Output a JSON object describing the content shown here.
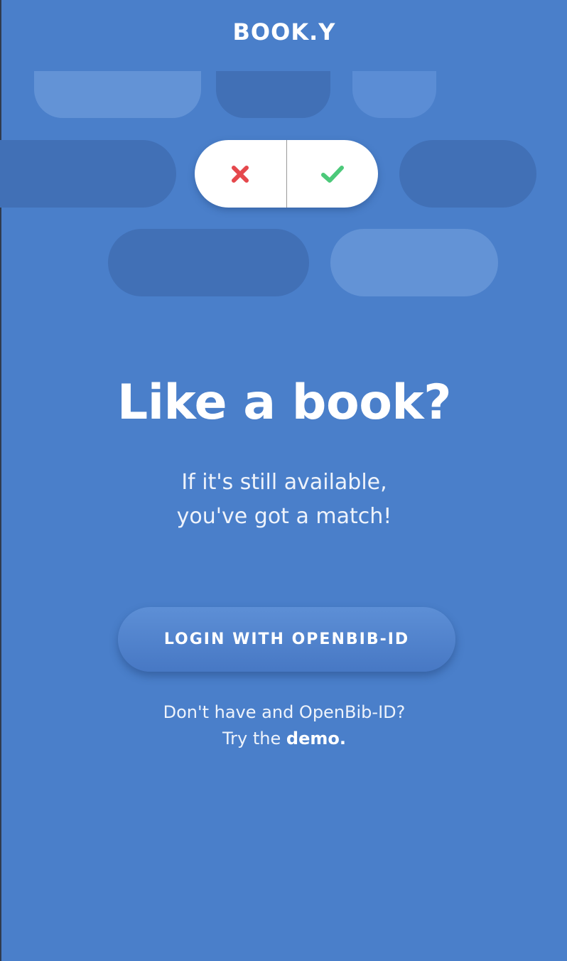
{
  "app": {
    "logo": "BOOK.Y"
  },
  "hero": {
    "headline": "Like a book?",
    "subline_1": "If it's still available,",
    "subline_2": "you've got a match!"
  },
  "toggle": {
    "reject_icon": "x-icon",
    "accept_icon": "check-icon"
  },
  "login": {
    "button_label": "LOGIN WITH OPENBIB-ID"
  },
  "helper": {
    "line_1": "Don't have and OpenBib-ID?",
    "line_2_prefix": "Try the ",
    "demo_link": "demo."
  },
  "colors": {
    "background": "#4a7fca",
    "reject": "#e5484d",
    "accept": "#4cc97a"
  }
}
